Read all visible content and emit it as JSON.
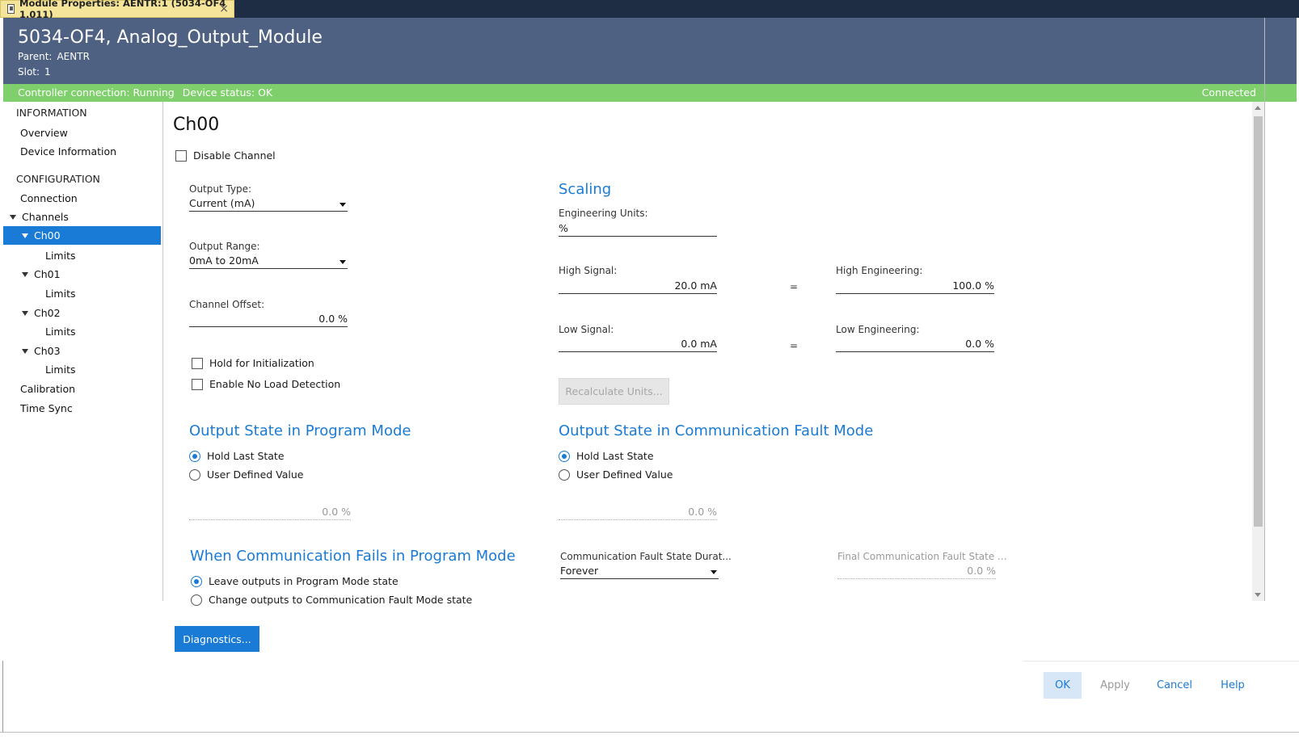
{
  "tab": {
    "title": "Module Properties:  AENTR:1 (5034-OF4 1.011)",
    "close": "×"
  },
  "header": {
    "title": "5034-OF4, Analog_Output_Module",
    "parent_label": "Parent:",
    "parent_value": "AENTR",
    "slot_label": "Slot:",
    "slot_value": "1"
  },
  "status": {
    "controller": "Controller connection: Running",
    "device": "Device status: OK",
    "connection": "Connected"
  },
  "nav": {
    "information": "INFORMATION",
    "overview": "Overview",
    "device_information": "Device Information",
    "configuration": "CONFIGURATION",
    "connection": "Connection",
    "channels": "Channels",
    "ch00": "Ch00",
    "ch00_limits": "Limits",
    "ch01": "Ch01",
    "ch01_limits": "Limits",
    "ch02": "Ch02",
    "ch02_limits": "Limits",
    "ch03": "Ch03",
    "ch03_limits": "Limits",
    "calibration": "Calibration",
    "time_sync": "Time Sync"
  },
  "main": {
    "title": "Ch00",
    "disable_channel": "Disable Channel",
    "output_type_label": "Output Type:",
    "output_type_value": "Current (mA)",
    "output_range_label": "Output Range:",
    "output_range_value": "0mA to 20mA",
    "channel_offset_label": "Channel Offset:",
    "channel_offset_value": "0.0 %",
    "hold_init": "Hold for Initialization",
    "no_load": "Enable No Load Detection",
    "scaling": {
      "title": "Scaling",
      "eng_units_label": "Engineering Units:",
      "eng_units_value": "%",
      "high_signal_label": "High Signal:",
      "high_signal_value": "20.0 mA",
      "high_eng_label": "High Engineering:",
      "high_eng_value": "100.0 %",
      "low_signal_label": "Low Signal:",
      "low_signal_value": "0.0 mA",
      "low_eng_label": "Low Engineering:",
      "low_eng_value": "0.0 %",
      "equals": "=",
      "recalc": "Recalculate Units..."
    },
    "program_mode": {
      "title": "Output State in Program Mode",
      "hold_last": "Hold Last State",
      "user_defined": "User Defined Value",
      "value": "0.0 %"
    },
    "comm_fault_mode": {
      "title": "Output State in Communication Fault Mode",
      "hold_last": "Hold Last State",
      "user_defined": "User Defined Value",
      "value": "0.0 %"
    },
    "comm_fails": {
      "title": "When Communication Fails in Program Mode",
      "leave": "Leave outputs in Program Mode state",
      "change": "Change outputs to Communication Fault Mode state"
    },
    "fault_duration_label": "Communication Fault State Durat...",
    "fault_duration_value": "Forever",
    "final_fault_label": "Final Communication Fault State ...",
    "final_fault_value": "0.0 %"
  },
  "buttons": {
    "diagnostics": "Diagnostics...",
    "ok": "OK",
    "apply": "Apply",
    "cancel": "Cancel",
    "help": "Help"
  },
  "colors": {
    "header_bg": "#4e6183",
    "status_bg": "#7fcf6c",
    "accent": "#1a7bd6",
    "tab_bg": "#f5e59a"
  }
}
